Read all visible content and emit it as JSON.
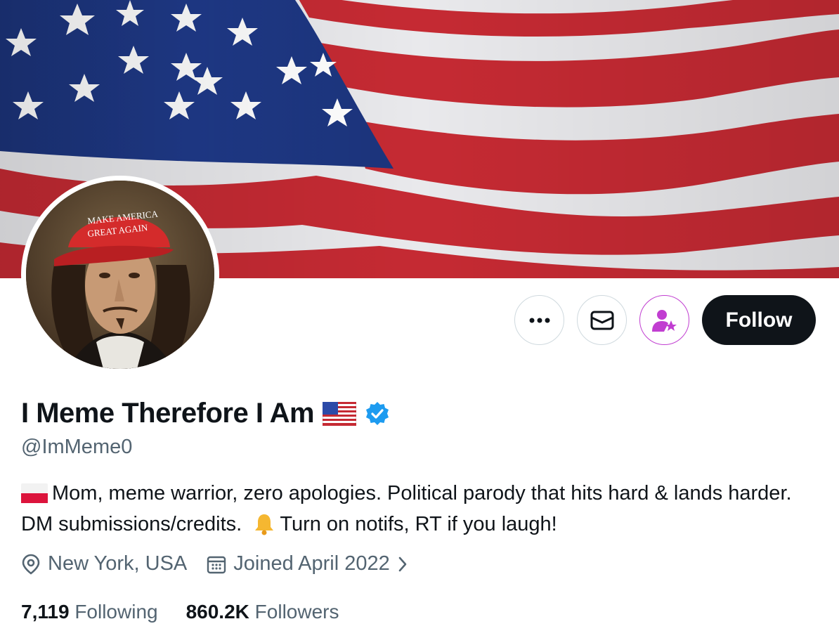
{
  "banner": {
    "icon": "us-flag-banner"
  },
  "avatar": {
    "hat_line1": "MAKE AMERICA",
    "hat_line2": "GREAT AGAIN"
  },
  "actions": {
    "more_icon": "more-icon",
    "message_icon": "envelope-icon",
    "subscribe_icon": "user-star-icon",
    "follow_label": "Follow"
  },
  "profile": {
    "display_name": "I Meme Therefore I Am",
    "name_flag_icon": "us-flag-icon",
    "verified_icon": "verified-badge-icon",
    "handle": "@ImMeme0",
    "bio_flag_icon": "poland-flag-icon",
    "bio_part1": "Mom, meme warrior, zero apologies. Political parody that hits hard & lands harder. DM submissions/credits.",
    "bio_bell_icon": "bell-icon",
    "bio_part2": "Turn on notifs, RT if you laugh!",
    "location": "New York, USA",
    "joined": "Joined April 2022"
  },
  "stats": {
    "following_count": "7,119",
    "following_label": "Following",
    "followers_count": "860.2K",
    "followers_label": "Followers"
  },
  "colors": {
    "follow_bg": "#0f1419",
    "verified_blue": "#1d9bf0",
    "subscribe_purple": "#c13ed1",
    "secondary_text": "#536471"
  }
}
